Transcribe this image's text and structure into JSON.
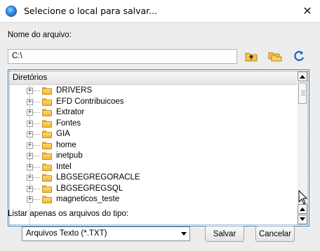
{
  "window": {
    "title": "Selecione o local para salvar...",
    "close_glyph": "✕"
  },
  "form": {
    "filename_label": "Nome do arquivo:",
    "filename_value": "C:\\",
    "filetype_label": "Listar apenas os arquivos do tipo:",
    "filetype_selected": "Arquivos Texto (*.TXT)"
  },
  "toolbar": {
    "up_folder_icon": "folder-up-icon",
    "new_folder_icon": "new-folder-icon",
    "refresh_icon": "refresh-icon"
  },
  "tree": {
    "header": "Diretórios",
    "items": [
      {
        "label": "DRIVERS",
        "expander": "+"
      },
      {
        "label": "EFD Contribuicoes",
        "expander": "+"
      },
      {
        "label": "Extrator",
        "expander": "+"
      },
      {
        "label": "Fontes",
        "expander": "+"
      },
      {
        "label": "GIA",
        "expander": "+"
      },
      {
        "label": "home",
        "expander": "+"
      },
      {
        "label": "inetpub",
        "expander": "+"
      },
      {
        "label": "Intel",
        "expander": "+"
      },
      {
        "label": "LBGSEGREGORACLE",
        "expander": "+"
      },
      {
        "label": "LBGSEGREGSQL",
        "expander": "+"
      },
      {
        "label": "magneticos_teste",
        "expander": "+"
      }
    ]
  },
  "buttons": {
    "save": "Salvar",
    "cancel": "Cancelar"
  },
  "colors": {
    "panel_border": "#3c7fb1",
    "folder": "#f2b737",
    "refresh": "#1a5fc2"
  }
}
